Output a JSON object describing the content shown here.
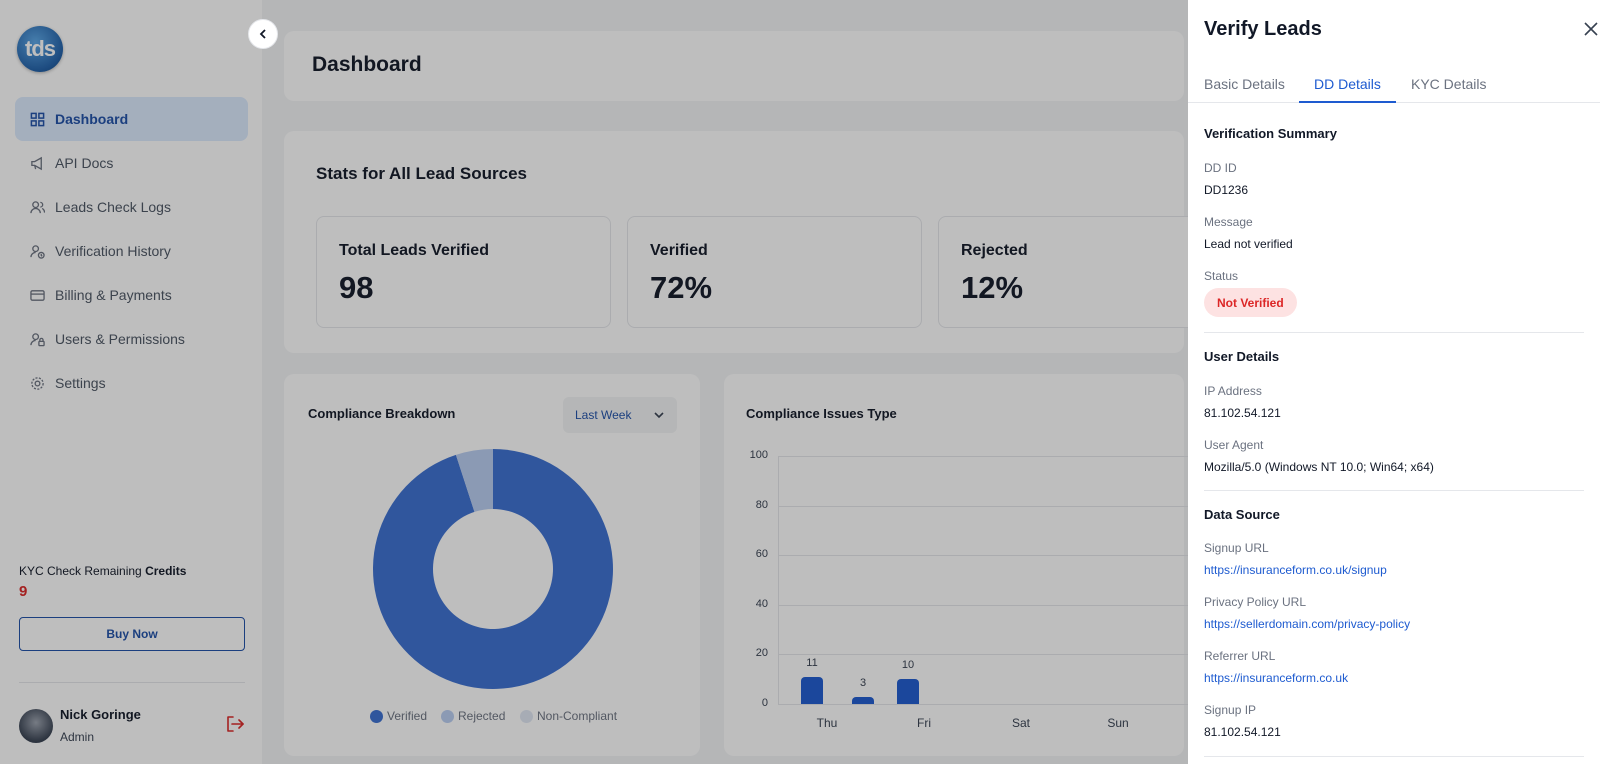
{
  "sidebar": {
    "logo_text": "tds",
    "items": [
      {
        "label": "Dashboard",
        "icon": "grid-icon"
      },
      {
        "label": "API Docs",
        "icon": "megaphone-icon"
      },
      {
        "label": "Leads Check Logs",
        "icon": "users-icon"
      },
      {
        "label": "Verification History",
        "icon": "user-clock-icon"
      },
      {
        "label": "Billing & Payments",
        "icon": "credit-card-icon"
      },
      {
        "label": "Users & Permissions",
        "icon": "user-lock-icon"
      },
      {
        "label": "Settings",
        "icon": "gear-icon"
      }
    ],
    "credits_label_prefix": "KYC Check Remaining ",
    "credits_label_bold": "Credits",
    "credits_value": "9",
    "buy_label": "Buy Now",
    "user": {
      "name": "Nick Goringe",
      "role": "Admin"
    }
  },
  "main": {
    "title": "Dashboard",
    "stats_title": "Stats for All Lead Sources",
    "stats": [
      {
        "label": "Total Leads Verified",
        "value": "98"
      },
      {
        "label": "Verified",
        "value": "72%"
      },
      {
        "label": "Rejected",
        "value": "12%"
      }
    ],
    "compliance_breakdown": {
      "title": "Compliance Breakdown",
      "period": "Last Week",
      "legend": [
        "Verified",
        "Rejected",
        "Non-Compliant"
      ]
    },
    "compliance_issues": {
      "title": "Compliance Issues Type"
    }
  },
  "chart_data": [
    {
      "type": "pie",
      "title": "Compliance Breakdown",
      "labels": [
        "Verified",
        "Rejected",
        "Non-Compliant"
      ],
      "values": [
        95,
        5,
        0
      ],
      "colors": [
        "#3b6fd1",
        "#b9cdf2",
        "#dfe6f3"
      ]
    },
    {
      "type": "bar",
      "title": "Compliance Issues Type",
      "categories": [
        "Thu",
        "Fri",
        "Sat",
        "Sun"
      ],
      "bars": [
        {
          "x": "Thu",
          "value": 11
        },
        {
          "x": "Thu",
          "value": 3
        },
        {
          "x": "Fri",
          "value": 10
        }
      ],
      "ylim": [
        0,
        100
      ],
      "yticks": [
        0,
        20,
        40,
        60,
        80,
        100
      ]
    }
  ],
  "drawer": {
    "title": "Verify Leads",
    "tabs": [
      "Basic Details",
      "DD Details",
      "KYC Details"
    ],
    "verification_summary": {
      "title": "Verification Summary",
      "dd_id_label": "DD ID",
      "dd_id": "DD1236",
      "message_label": "Message",
      "message": "Lead not verified",
      "status_label": "Status",
      "status": "Not Verified"
    },
    "user_details": {
      "title": "User Details",
      "ip_label": "IP Address",
      "ip": "81.102.54.121",
      "ua_label": "User Agent",
      "ua": "Mozilla/5.0 (Windows NT 10.0; Win64; x64)"
    },
    "data_source": {
      "title": "Data Source",
      "signup_url_label": "Signup URL",
      "signup_url": "https://insuranceform.co.uk/signup",
      "privacy_url_label": "Privacy Policy URL",
      "privacy_url": "https://sellerdomain.com/privacy-policy",
      "referrer_url_label": "Referrer URL",
      "referrer_url": "https://insuranceform.co.uk",
      "signup_ip_label": "Signup IP",
      "signup_ip": "81.102.54.121"
    }
  }
}
